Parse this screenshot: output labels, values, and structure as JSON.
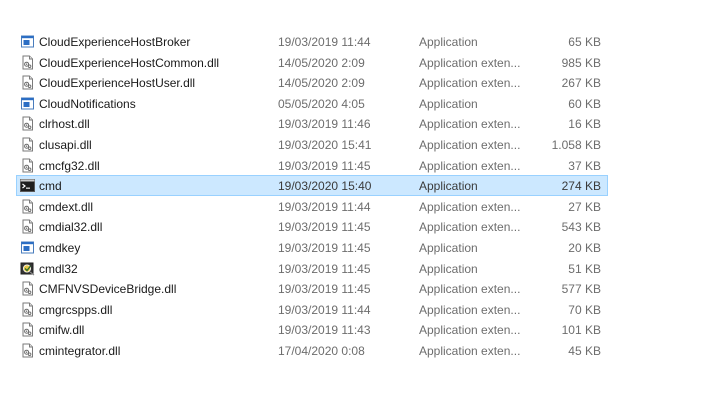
{
  "files": [
    {
      "name": "CloudExperienceHostBroker",
      "date": "19/03/2019 11:44",
      "type": "Application",
      "size": "65 KB",
      "icon": "app-icon",
      "selected": false
    },
    {
      "name": "CloudExperienceHostCommon.dll",
      "date": "14/05/2020 2:09",
      "type": "Application exten...",
      "size": "985 KB",
      "icon": "dll-icon",
      "selected": false
    },
    {
      "name": "CloudExperienceHostUser.dll",
      "date": "14/05/2020 2:09",
      "type": "Application exten...",
      "size": "267 KB",
      "icon": "dll-icon",
      "selected": false
    },
    {
      "name": "CloudNotifications",
      "date": "05/05/2020 4:05",
      "type": "Application",
      "size": "60 KB",
      "icon": "app-icon",
      "selected": false
    },
    {
      "name": "clrhost.dll",
      "date": "19/03/2019 11:46",
      "type": "Application exten...",
      "size": "16 KB",
      "icon": "dll-icon",
      "selected": false
    },
    {
      "name": "clusapi.dll",
      "date": "19/03/2020 15:41",
      "type": "Application exten...",
      "size": "1.058 KB",
      "icon": "dll-icon",
      "selected": false
    },
    {
      "name": "cmcfg32.dll",
      "date": "19/03/2019 11:45",
      "type": "Application exten...",
      "size": "37 KB",
      "icon": "dll-icon",
      "selected": false
    },
    {
      "name": "cmd",
      "date": "19/03/2020 15:40",
      "type": "Application",
      "size": "274 KB",
      "icon": "cmd-icon",
      "selected": true
    },
    {
      "name": "cmdext.dll",
      "date": "19/03/2019 11:44",
      "type": "Application exten...",
      "size": "27 KB",
      "icon": "dll-icon",
      "selected": false
    },
    {
      "name": "cmdial32.dll",
      "date": "19/03/2019 11:45",
      "type": "Application exten...",
      "size": "543 KB",
      "icon": "dll-icon",
      "selected": false
    },
    {
      "name": "cmdkey",
      "date": "19/03/2019 11:45",
      "type": "Application",
      "size": "20 KB",
      "icon": "app-icon",
      "selected": false
    },
    {
      "name": "cmdl32",
      "date": "19/03/2019 11:45",
      "type": "Application",
      "size": "51 KB",
      "icon": "cmdl32-icon",
      "selected": false
    },
    {
      "name": "CMFNVSDeviceBridge.dll",
      "date": "19/03/2019 11:45",
      "type": "Application exten...",
      "size": "577 KB",
      "icon": "dll-icon",
      "selected": false
    },
    {
      "name": "cmgrcspps.dll",
      "date": "19/03/2019 11:44",
      "type": "Application exten...",
      "size": "70 KB",
      "icon": "dll-icon",
      "selected": false
    },
    {
      "name": "cmifw.dll",
      "date": "19/03/2019 11:43",
      "type": "Application exten...",
      "size": "101 KB",
      "icon": "dll-icon",
      "selected": false
    },
    {
      "name": "cmintegrator.dll",
      "date": "17/04/2020 0:08",
      "type": "Application exten...",
      "size": "45 KB",
      "icon": "dll-icon",
      "selected": false
    }
  ]
}
